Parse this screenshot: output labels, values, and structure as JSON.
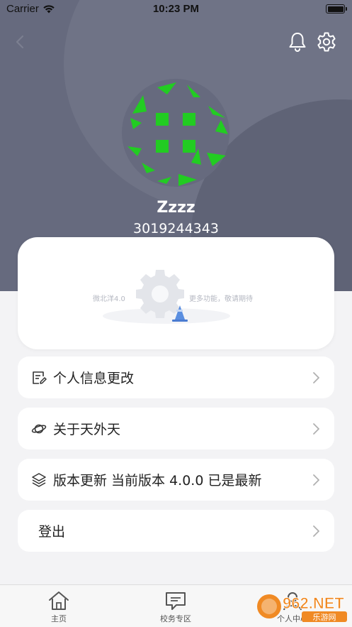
{
  "status_bar": {
    "carrier": "Carrier",
    "time": "10:23 PM"
  },
  "profile": {
    "username": "Zzzz",
    "user_id": "3019244343"
  },
  "promo_card": {
    "left_text": "微北洋4.0",
    "right_text": "更多功能，敬请期待"
  },
  "menu": [
    {
      "label": "个人信息更改",
      "icon": "edit-document-icon"
    },
    {
      "label": "关于天外天",
      "icon": "planet-icon"
    },
    {
      "label": "版本更新 当前版本 4.0.0 已是最新",
      "icon": "layers-icon"
    },
    {
      "label": "登出",
      "icon": ""
    }
  ],
  "tabbar": {
    "items": [
      {
        "label": "主页",
        "icon": "home-icon"
      },
      {
        "label": "校务专区",
        "icon": "message-icon"
      },
      {
        "label": "个人中心",
        "icon": "user-icon"
      }
    ]
  },
  "watermark": {
    "brand": "962.NET",
    "sub": "乐游网"
  },
  "colors": {
    "header": "#666a7e",
    "avatar_green": "#22cc22",
    "background": "#f3f3f5"
  }
}
